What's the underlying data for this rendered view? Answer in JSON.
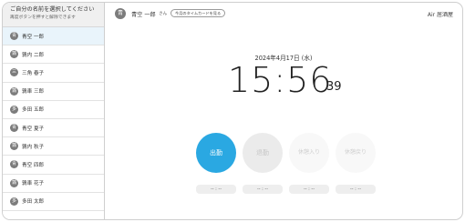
{
  "sidebar": {
    "title": "ご自分の名前を選択してください",
    "subtitle": "再度ボタンを押すと解除できます",
    "employees": [
      {
        "avatar": "青",
        "name": "青空 一郎"
      },
      {
        "avatar": "鶉",
        "name": "鶉内 二郎"
      },
      {
        "avatar": "三",
        "name": "三角 春子"
      },
      {
        "avatar": "鶉",
        "name": "鶉車 三郎"
      },
      {
        "avatar": "多",
        "name": "多田 五郎"
      },
      {
        "avatar": "青",
        "name": "青空 夏子"
      },
      {
        "avatar": "鶉",
        "name": "鶉内 秋子"
      },
      {
        "avatar": "青",
        "name": "青空 四郎"
      },
      {
        "avatar": "鶉",
        "name": "鶉車 花子"
      },
      {
        "avatar": "多",
        "name": "多田 太郎"
      }
    ]
  },
  "header": {
    "user_avatar": "青",
    "user_name": "青空 一郎",
    "user_suffix": "さん",
    "timecard_button": "今月のタイムカードを見る",
    "brand": "Air 居酒屋"
  },
  "clock": {
    "date": "2024年4月17日 (水)",
    "time": "15:56",
    "seconds": "39"
  },
  "punch_buttons": {
    "clock_in": "出勤",
    "clock_out": "退勤",
    "break_start": "休憩入り",
    "break_end": "休憩戻り"
  },
  "stamps": {
    "clock_in": "-- : --",
    "clock_out": "-- : --",
    "break_start": "-- : --",
    "break_end": "-- : --"
  },
  "colors": {
    "accent": "#2aa8e2",
    "selected_row": "#e9f4fb"
  }
}
